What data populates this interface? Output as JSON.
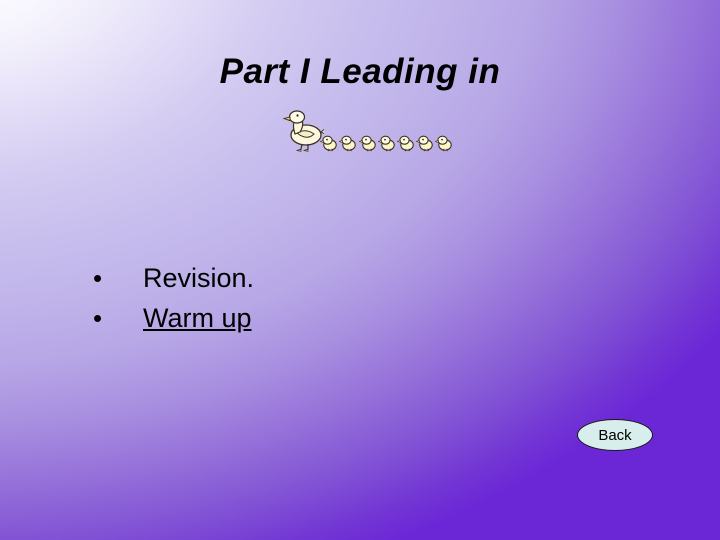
{
  "slide": {
    "title": "Part I Leading in",
    "background": {
      "start_color": "#ffffff",
      "mid_color": "#c0b4ea",
      "end_color": "#6b26d6"
    }
  },
  "artwork": {
    "name": "duck-family-clipart",
    "mother_duck_label": "mother-duck",
    "duckling_count": 7,
    "duckling_label": "duckling",
    "body_color": "#fdf6d2",
    "outline_color": "#3a3024",
    "beak_color": "#f2c83c"
  },
  "bullets": [
    {
      "marker": "•",
      "text": "Revision.",
      "is_link": false
    },
    {
      "marker": "•",
      "text": "Warm up",
      "is_link": true
    }
  ],
  "back_button": {
    "label": "Back",
    "fill_color": "#d8eeec",
    "border_color": "#1a1a1a"
  }
}
